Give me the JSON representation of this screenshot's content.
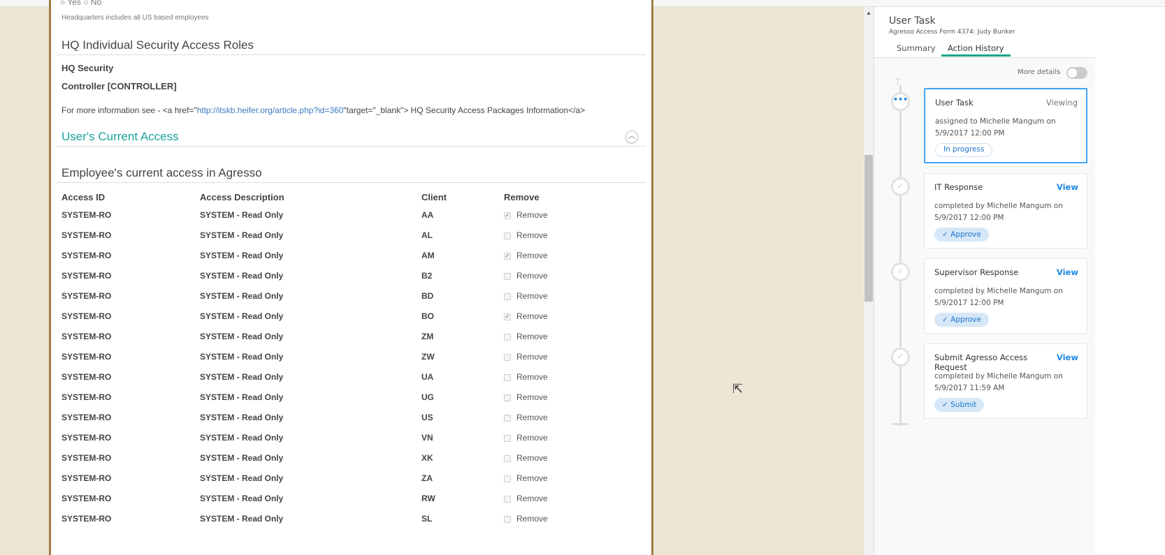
{
  "form": {
    "radio_yes": "Yes",
    "radio_no": "No",
    "hint": "Headquarters includes all US based employees",
    "roles_heading": "HQ Individual Security Access Roles",
    "hq_security": "HQ Security",
    "controller": "Controller [CONTROLLER]",
    "info_prefix": "For more information see - <a href=\"",
    "info_link": "http://itskb.heifer.org/article.php?id=360",
    "info_suffix": "\"target=\"_blank\"> HQ Security Access Packages Information</a>",
    "current_access_heading": "User's Current Access",
    "employee_heading": "Employee's current access in Agresso",
    "columns": [
      "Access ID",
      "Access Description",
      "Client",
      "Remove"
    ],
    "rows": [
      {
        "id": "SYSTEM-RO",
        "desc": "SYSTEM - Read Only",
        "client": "AA",
        "remove": "Remove",
        "checked": true
      },
      {
        "id": "SYSTEM-RO",
        "desc": "SYSTEM - Read Only",
        "client": "AL",
        "remove": "Remove",
        "checked": false
      },
      {
        "id": "SYSTEM-RO",
        "desc": "SYSTEM - Read Only",
        "client": "AM",
        "remove": "Remove",
        "checked": true
      },
      {
        "id": "SYSTEM-RO",
        "desc": "SYSTEM - Read Only",
        "client": "B2",
        "remove": "Remove",
        "checked": false
      },
      {
        "id": "SYSTEM-RO",
        "desc": "SYSTEM - Read Only",
        "client": "BD",
        "remove": "Remove",
        "checked": false
      },
      {
        "id": "SYSTEM-RO",
        "desc": "SYSTEM - Read Only",
        "client": "BO",
        "remove": "Remove",
        "checked": true
      },
      {
        "id": "SYSTEM-RO",
        "desc": "SYSTEM - Read Only",
        "client": "ZM",
        "remove": "Remove",
        "checked": false
      },
      {
        "id": "SYSTEM-RO",
        "desc": "SYSTEM - Read Only",
        "client": "ZW",
        "remove": "Remove",
        "checked": false
      },
      {
        "id": "SYSTEM-RO",
        "desc": "SYSTEM - Read Only",
        "client": "UA",
        "remove": "Remove",
        "checked": false
      },
      {
        "id": "SYSTEM-RO",
        "desc": "SYSTEM - Read Only",
        "client": "UG",
        "remove": "Remove",
        "checked": false
      },
      {
        "id": "SYSTEM-RO",
        "desc": "SYSTEM - Read Only",
        "client": "US",
        "remove": "Remove",
        "checked": false
      },
      {
        "id": "SYSTEM-RO",
        "desc": "SYSTEM - Read Only",
        "client": "VN",
        "remove": "Remove",
        "checked": false
      },
      {
        "id": "SYSTEM-RO",
        "desc": "SYSTEM - Read Only",
        "client": "XK",
        "remove": "Remove",
        "checked": false
      },
      {
        "id": "SYSTEM-RO",
        "desc": "SYSTEM - Read Only",
        "client": "ZA",
        "remove": "Remove",
        "checked": false
      },
      {
        "id": "SYSTEM-RO",
        "desc": "SYSTEM - Read Only",
        "client": "RW",
        "remove": "Remove",
        "checked": false
      },
      {
        "id": "SYSTEM-RO",
        "desc": "SYSTEM - Read Only",
        "client": "SL",
        "remove": "Remove",
        "checked": false
      }
    ]
  },
  "panel": {
    "title": "User Task",
    "subtitle": "Agresso Access Form 4374: Judy Bunker",
    "tabs": [
      "Summary",
      "Action History"
    ],
    "more_details": "More details",
    "history": [
      {
        "title": "User Task",
        "action": "Viewing",
        "line1": "assigned to Michelle Mangum on",
        "line2": "5/9/2017 12:00 PM",
        "badge": "In progress",
        "current": true
      },
      {
        "title": "IT Response",
        "action": "View",
        "line1": "completed by Michelle Mangum on",
        "line2": "5/9/2017 12:00 PM",
        "badge": "Approve",
        "current": false
      },
      {
        "title": "Supervisor Response",
        "action": "View",
        "line1": "completed by Michelle Mangum on",
        "line2": "5/9/2017 12:00 PM",
        "badge": "Approve",
        "current": false
      },
      {
        "title": "Submit Agresso Access Request",
        "action": "View",
        "line1": "completed by Michelle Mangum on",
        "line2": "5/9/2017 11:59 AM",
        "badge": "Submit",
        "current": false
      }
    ]
  }
}
